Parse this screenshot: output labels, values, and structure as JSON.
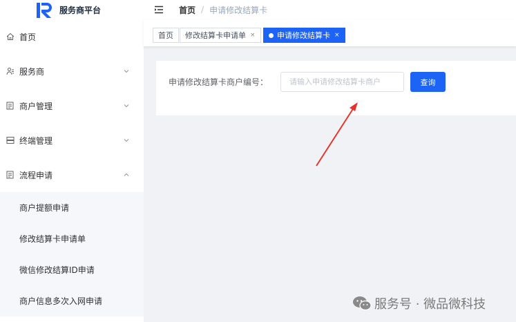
{
  "app": {
    "title": "服务商平台"
  },
  "sidebar": {
    "items": [
      {
        "label": "首页",
        "icon": "home-icon"
      },
      {
        "label": "服务商",
        "icon": "user-group-icon",
        "chevron": "down"
      },
      {
        "label": "商户管理",
        "icon": "merchant-icon",
        "chevron": "down"
      },
      {
        "label": "终端管理",
        "icon": "terminal-icon",
        "chevron": "down"
      },
      {
        "label": "流程申请",
        "icon": "process-icon",
        "chevron": "up"
      }
    ],
    "submenu": [
      {
        "label": "商户提额申请"
      },
      {
        "label": "修改结算卡申请单"
      },
      {
        "label": "微信修改结算ID申请"
      },
      {
        "label": "商户信息多次入网申请"
      }
    ]
  },
  "header": {
    "breadcrumb": {
      "home": "首页",
      "separator": "/",
      "current": "申请修改结算卡"
    }
  },
  "tags": [
    {
      "label": "首页",
      "closable": false,
      "active": false
    },
    {
      "label": "修改结算卡申请单",
      "closable": true,
      "active": false
    },
    {
      "label": "申请修改结算卡",
      "closable": true,
      "active": true
    }
  ],
  "tag_close": "×",
  "form": {
    "label": "申请修改结算卡商户编号：",
    "input_value": "",
    "input_placeholder": "请输入申请修改结算卡商户",
    "query_button": "查询"
  },
  "watermark": {
    "text": "服务号 · 微品微科技"
  },
  "colors": {
    "primary": "#1d63f5",
    "arrow": "#e8332a"
  }
}
